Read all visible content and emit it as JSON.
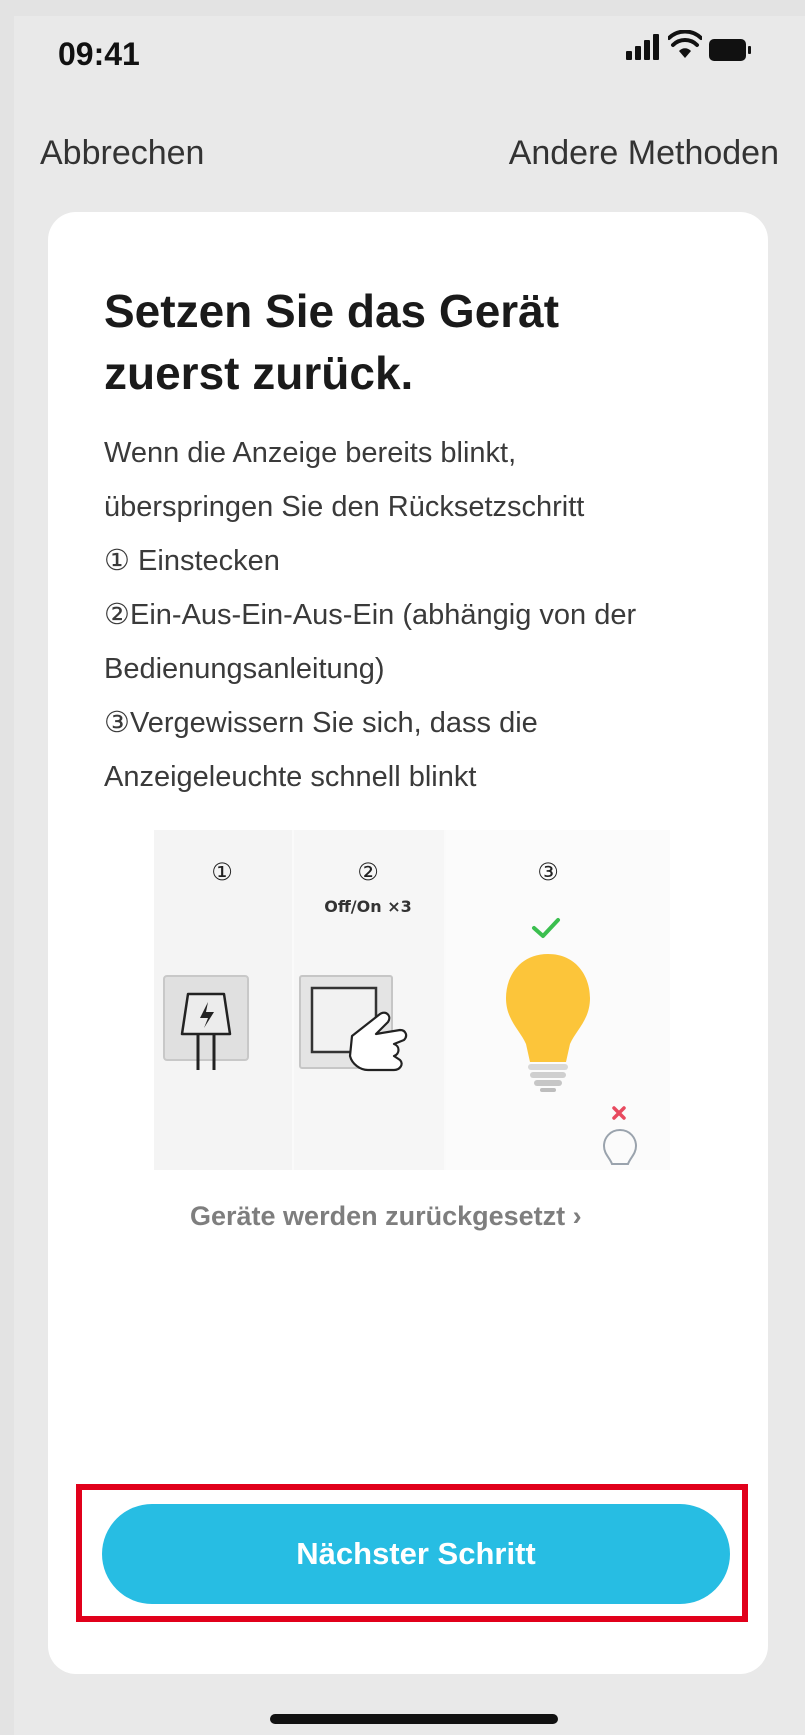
{
  "status_bar": {
    "time": "09:41",
    "icons": [
      "signal-icon",
      "wifi-icon",
      "battery-icon"
    ]
  },
  "nav": {
    "cancel_label": "Abbrechen",
    "other_methods_label": "Andere Methoden"
  },
  "content": {
    "title_line1": "Setzen Sie das Gerät",
    "title_line2": "zuerst zurück.",
    "instruction_lines": [
      "Wenn die Anzeige bereits blinkt,",
      "überspringen Sie den Rücksetzschritt",
      "① Einstecken",
      "②Ein-Aus-Ein-Aus-Ein (abhängig von der",
      "Bedienungsanleitung)",
      "③Vergewissern Sie sich, dass die",
      "Anzeigeleuchte schnell blinkt"
    ]
  },
  "illustration": {
    "step_labels": [
      "①",
      "②",
      "③"
    ],
    "step2_caption": "Off/On ×3",
    "icons": [
      "plug-icon",
      "light-switch-icon",
      "bulb-on-icon",
      "check-icon",
      "cross-icon",
      "bulb-off-icon"
    ]
  },
  "reset_link": {
    "label": "Geräte werden zurückgesetzt ›"
  },
  "primary_button": {
    "label": "Nächster Schritt"
  },
  "colors": {
    "accent": "#27bde3",
    "highlight_border": "#e1001b",
    "bulb": "#fcc53a",
    "check": "#3bbf4f",
    "cross": "#e84a5f"
  }
}
